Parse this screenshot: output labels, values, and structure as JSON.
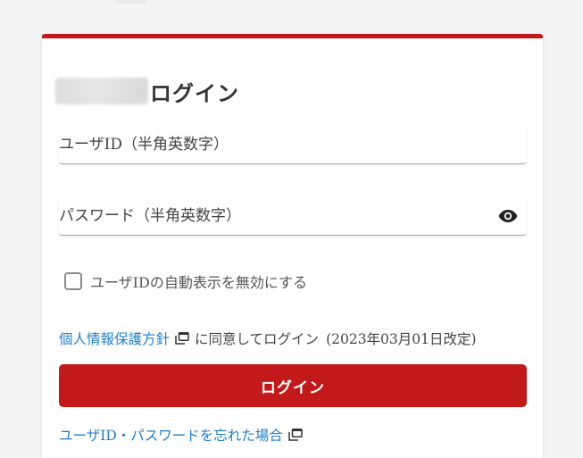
{
  "header": {
    "title": "ログイン"
  },
  "form": {
    "userid_placeholder": "ユーザID（半角英数字）",
    "password_placeholder": "パスワード（半角英数字）",
    "show_password_icon": "eye-icon",
    "disable_autofill_label": "ユーザIDの自動表示を無効にする",
    "disable_autofill_checked": false
  },
  "policy": {
    "link_text": "個人情報保護方針",
    "link_icon": "external-window-icon",
    "agree_text": "に同意してログイン",
    "revised_date": "(2023年03月01日改定)"
  },
  "actions": {
    "login_label": "ログイン",
    "forgot_link": "ユーザID・パスワードを忘れた場合",
    "forgot_icon": "external-window-icon"
  },
  "colors": {
    "accent": "#c21a1a",
    "link": "#1f7ec9"
  }
}
